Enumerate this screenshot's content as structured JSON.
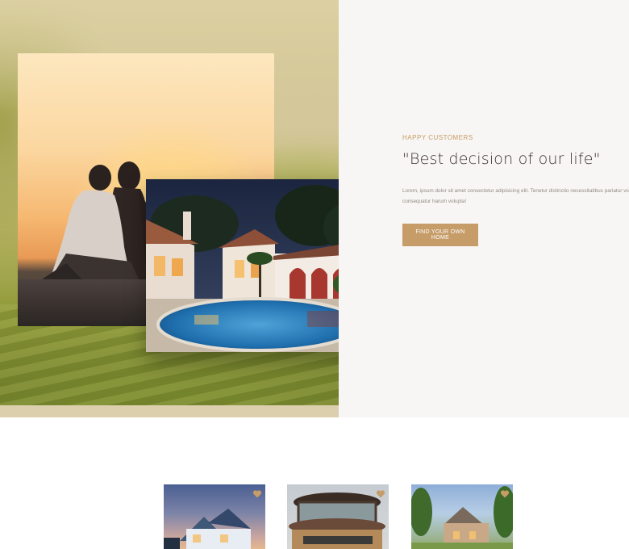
{
  "hero": {
    "images": {
      "sunset": "couple-watching-sunset-photo",
      "villa": "villa-with-pool-at-night-photo"
    },
    "eyebrow": "HAPPY CUSTOMERS",
    "quote": "\"Best decision of our life\"",
    "body_line_1": "Lorem, ipsum dolor sit amet consectetur adipisicing elit. Tenetur distinctio necessitatibus pariatur voluptatibus,",
    "body_line_2": "consequatur harum volupta!",
    "cta_label": "FIND YOUR OWN HOME"
  },
  "listings": {
    "cards": [
      {
        "image": "blue-house-photo",
        "icon": "heart-icon"
      },
      {
        "image": "round-modern-house-photo",
        "icon": "heart-icon"
      },
      {
        "image": "brick-house-photo",
        "icon": "heart-icon"
      }
    ]
  },
  "colors": {
    "accent": "#c69c68",
    "panel_bg": "#f8f6f4",
    "heading": "#3b3230",
    "body_text": "#8f8a85"
  }
}
